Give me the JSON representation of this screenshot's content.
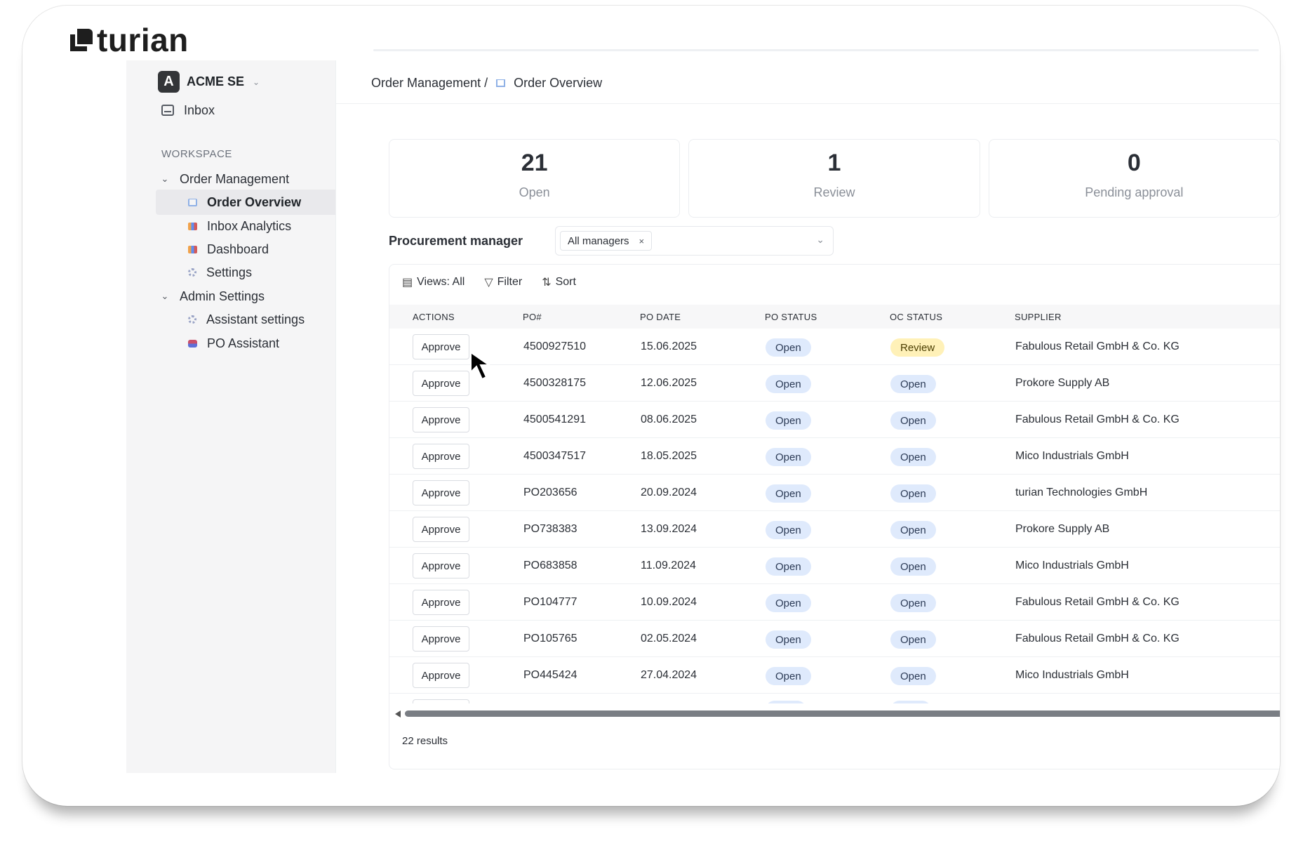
{
  "brand": {
    "name": "turian"
  },
  "org": {
    "initial": "A",
    "name": "ACME SE",
    "caret": "⌄"
  },
  "sidebar": {
    "inbox": "Inbox",
    "section": "WORKSPACE",
    "groups": [
      {
        "label": "Order Management",
        "items": [
          {
            "label": "Order Overview",
            "icon": "book-icon",
            "active": true
          },
          {
            "label": "Inbox Analytics",
            "icon": "chart-icon"
          },
          {
            "label": "Dashboard",
            "icon": "chart-icon"
          },
          {
            "label": "Settings",
            "icon": "gear-icon"
          }
        ]
      },
      {
        "label": "Admin Settings",
        "items": [
          {
            "label": "Assistant settings",
            "icon": "gear-icon"
          },
          {
            "label": "PO Assistant",
            "icon": "robot-icon"
          }
        ]
      }
    ]
  },
  "breadcrumb": {
    "parent": "Order Management /",
    "current": "Order Overview"
  },
  "stats": [
    {
      "value": "21",
      "label": "Open"
    },
    {
      "value": "1",
      "label": "Review"
    },
    {
      "value": "0",
      "label": "Pending approval"
    }
  ],
  "filter": {
    "label": "Procurement manager",
    "chip": "All managers",
    "chip_remove": "×",
    "caret": "⌄"
  },
  "toolbar": {
    "views": "Views: All",
    "filter": "Filter",
    "sort": "Sort"
  },
  "table": {
    "headers": [
      "ACTIONS",
      "PO#",
      "PO DATE",
      "PO STATUS",
      "OC STATUS",
      "SUPPLIER"
    ],
    "action_label": "Approve",
    "rows": [
      {
        "po": "4500927510",
        "date": "15.06.2025",
        "po_status": "Open",
        "oc_status": "Review",
        "supplier": "Fabulous Retail GmbH & Co. KG"
      },
      {
        "po": "4500328175",
        "date": "12.06.2025",
        "po_status": "Open",
        "oc_status": "Open",
        "supplier": "Prokore Supply AB"
      },
      {
        "po": "4500541291",
        "date": "08.06.2025",
        "po_status": "Open",
        "oc_status": "Open",
        "supplier": "Fabulous Retail GmbH & Co. KG"
      },
      {
        "po": "4500347517",
        "date": "18.05.2025",
        "po_status": "Open",
        "oc_status": "Open",
        "supplier": "Mico Industrials GmbH"
      },
      {
        "po": "PO203656",
        "date": "20.09.2024",
        "po_status": "Open",
        "oc_status": "Open",
        "supplier": "turian Technologies GmbH"
      },
      {
        "po": "PO738383",
        "date": "13.09.2024",
        "po_status": "Open",
        "oc_status": "Open",
        "supplier": "Prokore Supply AB"
      },
      {
        "po": "PO683858",
        "date": "11.09.2024",
        "po_status": "Open",
        "oc_status": "Open",
        "supplier": "Mico Industrials GmbH"
      },
      {
        "po": "PO104777",
        "date": "10.09.2024",
        "po_status": "Open",
        "oc_status": "Open",
        "supplier": "Fabulous Retail GmbH & Co. KG"
      },
      {
        "po": "PO105765",
        "date": "02.05.2024",
        "po_status": "Open",
        "oc_status": "Open",
        "supplier": "Fabulous Retail GmbH & Co. KG"
      },
      {
        "po": "PO445424",
        "date": "27.04.2024",
        "po_status": "Open",
        "oc_status": "Open",
        "supplier": "Mico Industrials GmbH"
      }
    ],
    "results": "22 results"
  },
  "colors": {
    "pill_open": "#dfeafc",
    "pill_review": "#fff1b8",
    "sidebar_bg": "#f5f5f6"
  }
}
